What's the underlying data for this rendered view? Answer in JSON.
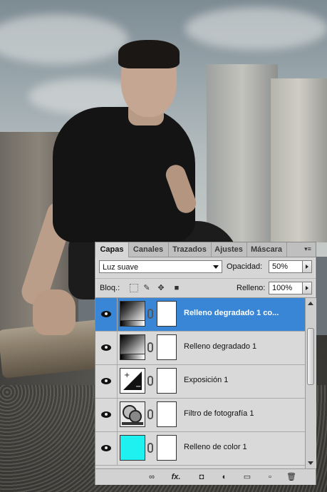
{
  "panel": {
    "tabs": [
      "Capas",
      "Canales",
      "Trazados",
      "Ajustes",
      "Máscara"
    ],
    "active_tab": "Capas",
    "menu_icon": "panel-menu-icon",
    "blend_mode": "Luz suave",
    "opacity_label": "Opacidad:",
    "opacity_value": "50%",
    "lock_label": "Bloq.:",
    "fill_label": "Relleno:",
    "fill_value": "100%",
    "layers": [
      {
        "name": "Relleno degradado 1 co...",
        "selected": true,
        "thumb": "gradient-icon"
      },
      {
        "name": "Relleno degradado 1",
        "selected": false,
        "thumb": "gradient-icon"
      },
      {
        "name": "Exposición 1",
        "selected": false,
        "thumb": "exposure-icon"
      },
      {
        "name": "Filtro de fotografía 1",
        "selected": false,
        "thumb": "photo-filter-icon"
      },
      {
        "name": "Relleno de color 1",
        "selected": false,
        "thumb": "color-fill-icon",
        "color": "#1ff0f0"
      }
    ],
    "footer": {
      "link_glyph": "∞",
      "fx_glyph": "fx.",
      "mask_glyph": "◘",
      "adjust_glyph": "◐",
      "folder_glyph": "▭",
      "new_glyph": "▫",
      "trash_glyph": "🗑"
    }
  },
  "colors": {
    "selection": "#3a86d6",
    "panel_bg": "#d6d6d6",
    "color_fill": "#1ff0f0"
  }
}
